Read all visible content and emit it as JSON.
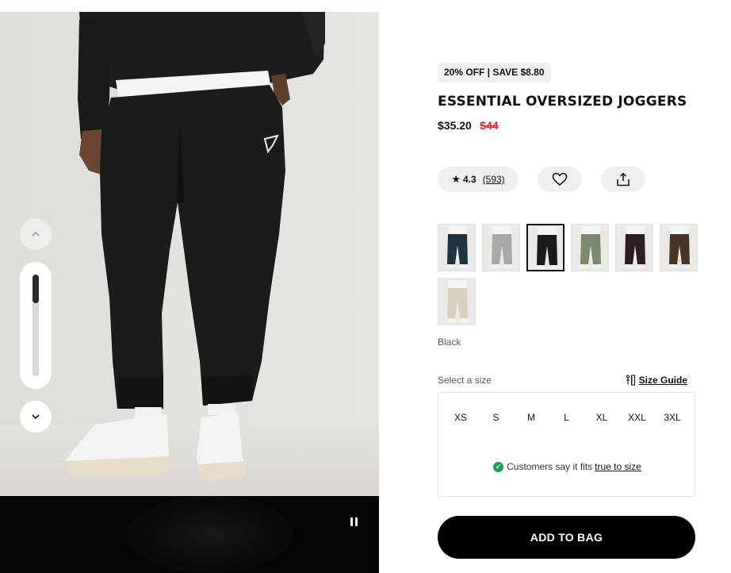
{
  "product": {
    "promo_badge": "20% OFF | SAVE $8.80",
    "title": "ESSENTIAL OVERSIZED JOGGERS",
    "price": "$35.20",
    "original_price": "$44"
  },
  "rating": {
    "score": "4.3",
    "count": "(593)",
    "icon": "star-icon"
  },
  "actions": {
    "wishlist_icon": "heart-icon",
    "share_icon": "share-icon"
  },
  "colors": {
    "selected_name": "Black",
    "swatches": [
      {
        "name": "Navy",
        "pants": "#1f3340",
        "selected": false
      },
      {
        "name": "Grey",
        "pants": "#a9a9ab",
        "selected": false
      },
      {
        "name": "Black",
        "pants": "#1a1a1a",
        "selected": true
      },
      {
        "name": "Sage Green",
        "pants": "#7a8a6c",
        "selected": false
      },
      {
        "name": "Plum",
        "pants": "#2e1d25",
        "selected": false
      },
      {
        "name": "Brown",
        "pants": "#4a3424",
        "selected": false
      },
      {
        "name": "Stone",
        "pants": "#d8d0bd",
        "selected": false
      }
    ]
  },
  "size": {
    "prompt": "Select a size",
    "guide_label": "Size Guide",
    "options": [
      "XS",
      "S",
      "M",
      "L",
      "XL",
      "XXL",
      "3XL"
    ],
    "fit_text": "Customers say it fits",
    "fit_link": "true to size"
  },
  "cta": {
    "add_to_bag": "ADD TO BAG"
  },
  "gallery": {
    "thumb_position": 0.0,
    "media_state": "playing"
  },
  "colors_palette": {
    "sale_red": "#d22a2a",
    "fit_green": "#1f9d55",
    "cta_black": "#000000"
  }
}
